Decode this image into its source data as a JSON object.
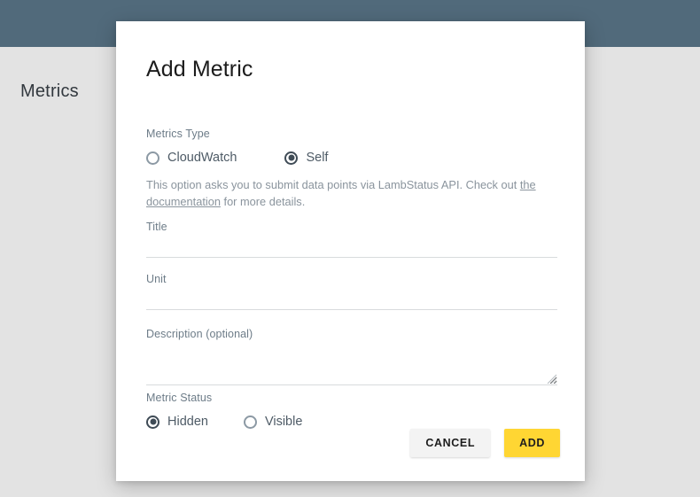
{
  "background": {
    "page_title": "Metrics",
    "top_bar_color": "#536d7e",
    "page_bg_color": "#e8e8e8"
  },
  "dialog": {
    "title": "Add Metric",
    "metrics_type": {
      "label": "Metrics Type",
      "options": [
        {
          "label": "CloudWatch",
          "selected": false
        },
        {
          "label": "Self",
          "selected": true
        }
      ],
      "help_text_before_link": "This option asks you to submit data points via LambStatus API. Check out ",
      "help_link_text": "the documentation",
      "help_text_after_link": " for more details."
    },
    "fields": {
      "title": {
        "label": "Title",
        "value": "",
        "placeholder": ""
      },
      "unit": {
        "label": "Unit",
        "value": "",
        "placeholder": ""
      },
      "description": {
        "label": "Description (optional)",
        "value": "",
        "placeholder": ""
      }
    },
    "metric_status": {
      "label": "Metric Status",
      "options": [
        {
          "label": "Hidden",
          "selected": true
        },
        {
          "label": "Visible",
          "selected": false
        }
      ]
    },
    "actions": {
      "cancel_label": "CANCEL",
      "add_label": "ADD",
      "add_color": "#ffd633",
      "cancel_color": "#f3f3f3"
    }
  }
}
